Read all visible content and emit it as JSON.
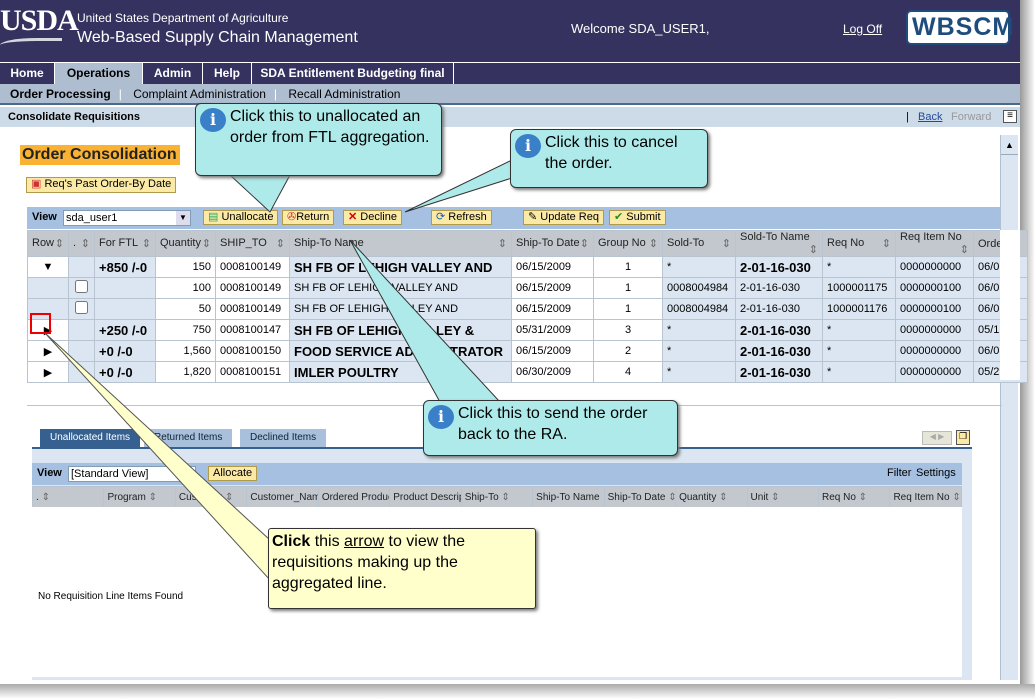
{
  "header": {
    "logo": "USDA",
    "org": "United States Department of Agriculture",
    "app_title": "Web-Based Supply Chain Management",
    "welcome": "Welcome SDA_USER1,",
    "logoff": "Log Off",
    "brand_logo": "WBSCM"
  },
  "tabs": [
    "Home",
    "Operations",
    "Admin",
    "Help",
    "SDA Entitlement Budgeting final"
  ],
  "subnav": [
    "Order Processing",
    "Complaint Administration",
    "Recall Administration"
  ],
  "breadcrumb": {
    "title": "Consolidate Requisitions",
    "back": "Back",
    "forward": "Forward"
  },
  "page": {
    "title": "Order Consolidation",
    "past_button": "Req's Past Order-By Date"
  },
  "toolbar": {
    "view_label": "View",
    "view_value": "sda_user1",
    "unallocate": "Unallocate",
    "return": "Return",
    "decline": "Decline",
    "refresh": "Refresh",
    "update_req": "Update Req",
    "submit": "Submit"
  },
  "table": {
    "columns": [
      "Row",
      ".",
      "For FTL",
      "Quantity",
      "SHIP_TO",
      "Ship-To Name",
      "Ship-To Date",
      "Group No",
      "Sold-To",
      "Sold-To Name",
      "Req No",
      "Req Item No",
      "Orde"
    ],
    "rows": [
      {
        "expand": "expanded",
        "ftl": "+850 /-0",
        "qty": "150",
        "ship_to": "0008100149",
        "name": "SH FB OF LEHIGH VALLEY AND",
        "date": "06/15/2009",
        "group": "1",
        "sold_to": "*",
        "sold_name": "2-01-16-030",
        "req_no": "*",
        "req_item": "0000000000",
        "order": "06/0",
        "bold": true
      },
      {
        "expand": "",
        "ftl": "",
        "qty": "100",
        "ship_to": "0008100149",
        "name": "SH FB OF LEHIGH VALLEY AND",
        "date": "06/15/2009",
        "group": "1",
        "sold_to": "0008004984",
        "sold_name": "2-01-16-030",
        "req_no": "1000001175",
        "req_item": "0000000100",
        "order": "06/0",
        "bold": false
      },
      {
        "expand": "",
        "ftl": "",
        "qty": "50",
        "ship_to": "0008100149",
        "name": "SH FB OF LEHIGH VALLEY AND",
        "date": "06/15/2009",
        "group": "1",
        "sold_to": "0008004984",
        "sold_name": "2-01-16-030",
        "req_no": "1000001176",
        "req_item": "0000000100",
        "order": "06/0",
        "bold": false
      },
      {
        "expand": "collapsed",
        "ftl": "+250 /-0",
        "qty": "750",
        "ship_to": "0008100147",
        "name": "SH FB OF LEHIGH VALLEY &",
        "date": "05/31/2009",
        "group": "3",
        "sold_to": "*",
        "sold_name": "2-01-16-030",
        "req_no": "*",
        "req_item": "0000000000",
        "order": "05/1",
        "bold": true
      },
      {
        "expand": "collapsed",
        "ftl": "+0 /-0",
        "qty": "1,560",
        "ship_to": "0008100150",
        "name": "FOOD SERVICE ADMINISTRATOR",
        "date": "06/15/2009",
        "group": "2",
        "sold_to": "*",
        "sold_name": "2-01-16-030",
        "req_no": "*",
        "req_item": "0000000000",
        "order": "06/0",
        "bold": true
      },
      {
        "expand": "collapsed",
        "ftl": "+0 /-0",
        "qty": "1,820",
        "ship_to": "0008100151",
        "name": "IMLER POULTRY",
        "date": "06/30/2009",
        "group": "4",
        "sold_to": "*",
        "sold_name": "2-01-16-030",
        "req_no": "*",
        "req_item": "0000000000",
        "order": "05/2",
        "bold": true
      }
    ]
  },
  "lower": {
    "tabs": [
      "Unallocated Items",
      "Returned Items",
      "Declined Items"
    ],
    "view_label": "View",
    "view_value": "[Standard View]",
    "allocate": "Allocate",
    "filter": "Filter",
    "settings": "Settings",
    "columns": [
      ".",
      "Program",
      "Customer",
      "Customer_Name",
      "Ordered Product",
      "Product Description",
      "Ship-To",
      "Ship-To Name",
      "Ship-To Date",
      "Quantity",
      "Unit",
      "Req No",
      "Req Item No"
    ],
    "empty": "No Requisition Line Items Found"
  },
  "callouts": {
    "unallocate": "Click this to unallocated an order from FTL aggregation.",
    "decline": "Click this to cancel the order.",
    "return": "Click this to send the order back to the RA.",
    "arrow_bold": "Click",
    "arrow_pre": " this ",
    "arrow_link": "arrow",
    "arrow_post": " to view the requisitions making up the aggregated line."
  },
  "colors": {
    "header": "#35325f",
    "accent": "#f9b233",
    "callout": "#aeeaea",
    "note": "#ffffcc"
  }
}
